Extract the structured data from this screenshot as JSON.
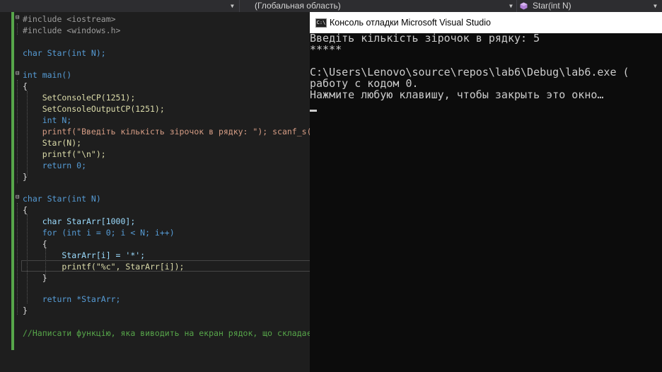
{
  "navbar": {
    "scope": "(Глобальная область)",
    "member": "Star(int N)"
  },
  "editor": {
    "lines": [
      "#include <iostream>",
      "#include <windows.h>",
      "",
      "char Star(int N);",
      "",
      "int main()",
      "{",
      "    SetConsoleCP(1251);",
      "    SetConsoleOutputCP(1251);",
      "    int N;",
      "    printf(\"Введіть кількість зірочок в рядку: \"); scanf_s(\"%",
      "    Star(N);",
      "    printf(\"\\n\");",
      "    return 0;",
      "}",
      "",
      "char Star(int N)",
      "{",
      "    char StarArr[1000];",
      "    for (int i = 0; i < N; i++)",
      "    {",
      "        StarArr[i] = '*';",
      "        printf(\"%c\", StarArr[i]);",
      "    }",
      "",
      "    return *StarArr;",
      "}",
      "",
      "//Написати функцію, яка виводить на екран рядок, що складаєть"
    ]
  },
  "console": {
    "title": "Консоль отладки Microsoft Visual Studio",
    "icon_text": "C:\\",
    "lines": [
      "Введіть кількість зірочок в рядку: 5",
      "*****",
      "",
      "C:\\Users\\Lenovo\\source\\repos\\lab6\\Debug\\lab6.exe (",
      "работу с кодом 0.",
      "Нажмите любую клавишу, чтобы закрыть это окно…"
    ]
  }
}
